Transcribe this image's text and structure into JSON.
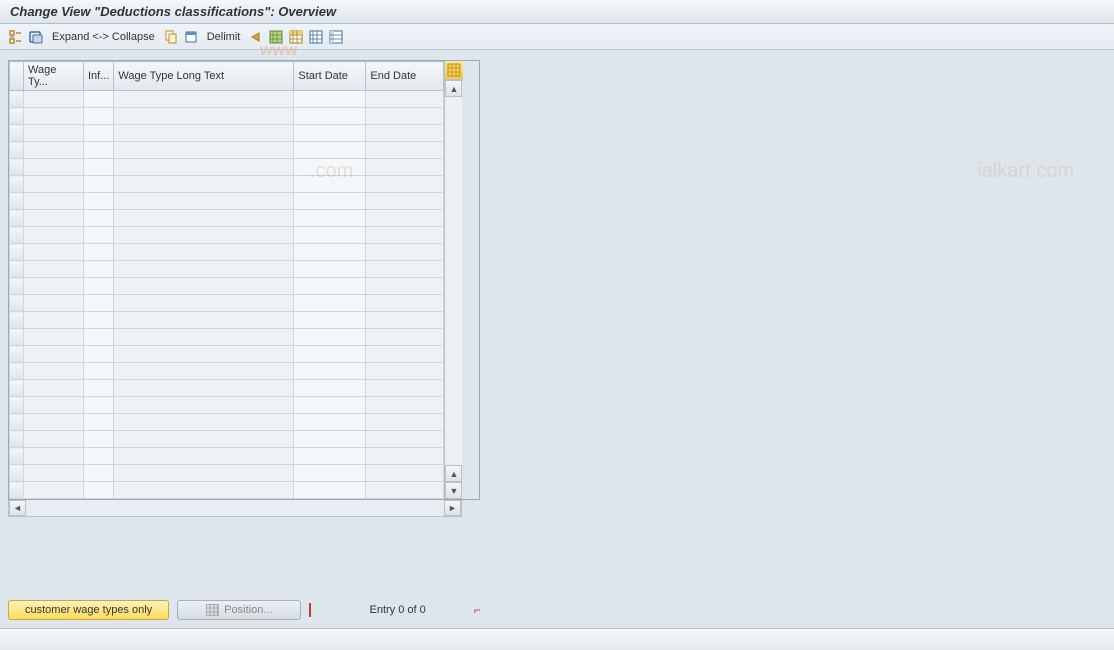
{
  "title": "Change View \"Deductions classifications\": Overview",
  "toolbar": {
    "expand_collapse": "Expand <-> Collapse",
    "delimit": "Delimit"
  },
  "table": {
    "columns": {
      "wage": "Wage Ty...",
      "inf": "Inf...",
      "long": "Wage Type Long Text",
      "start": "Start Date",
      "end": "End Date"
    },
    "row_count": 24
  },
  "footer": {
    "customer_btn": "customer wage types only",
    "position_btn": "Position...",
    "entry_text": "Entry 0 of 0"
  }
}
